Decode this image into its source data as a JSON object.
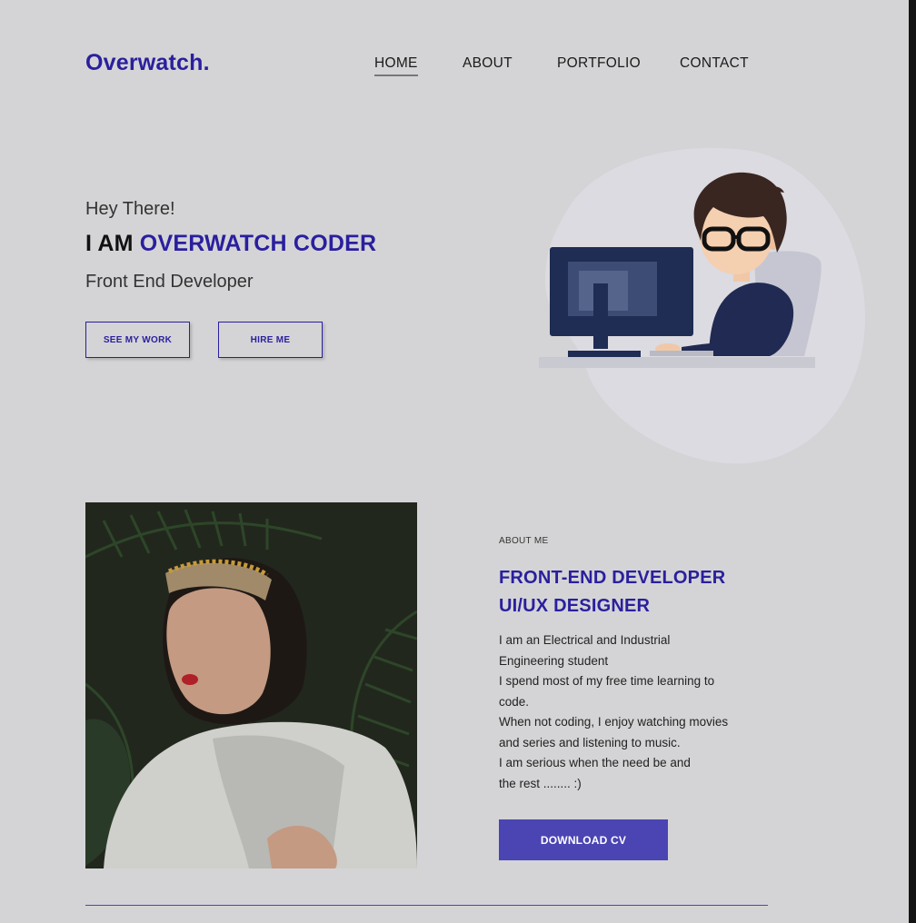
{
  "header": {
    "logo": "Overwatch.",
    "nav": [
      {
        "label": "HOME",
        "active": true
      },
      {
        "label": "ABOUT",
        "active": false
      },
      {
        "label": "PORTFOLIO",
        "active": false
      },
      {
        "label": "CONTACT",
        "active": false
      }
    ]
  },
  "hero": {
    "greeting": "Hey There!",
    "headline_prefix": "I AM ",
    "headline_name": "OVERWATCH CODER",
    "role": "Front End Developer",
    "btn_work": "SEE MY WORK",
    "btn_hire": "HIRE ME"
  },
  "about": {
    "label": "ABOUT ME",
    "title_line1": "FRONT-END DEVELOPER",
    "title_line2": "UI/UX DESIGNER",
    "text_lines": [
      "I am an Electrical and Industrial",
      "Engineering student",
      "I spend most of my free time learning to",
      "code.",
      "When not coding, I enjoy watching movies",
      "and series and listening to music.",
      "I am serious when the need be and",
      "the rest ........ :)"
    ],
    "download_btn": "DOWNLOAD CV"
  },
  "colors": {
    "accent": "#2a1f9e",
    "button_fill": "#4b44b3",
    "background": "#d4d4d6"
  }
}
